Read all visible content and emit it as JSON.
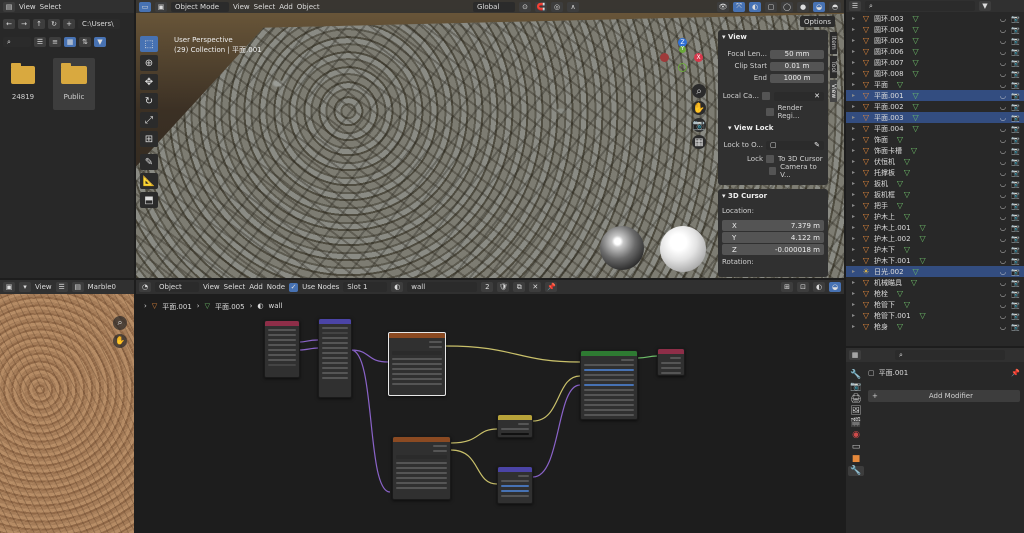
{
  "file_browser": {
    "view": "View",
    "select": "Select",
    "path": "C:\\Users\\",
    "items": [
      {
        "name": "24819"
      },
      {
        "name": "Public"
      }
    ]
  },
  "viewport": {
    "mode": "Object Mode",
    "view": "View",
    "select": "Select",
    "add": "Add",
    "object": "Object",
    "orientation": "Global",
    "options": "Options",
    "info_line1": "User Perspective",
    "info_line2": "(29) Collection | 平面.001",
    "axes": {
      "z": "Z",
      "y": "Y",
      "x": "X"
    }
  },
  "n_panel": {
    "tabs": [
      "Item",
      "Tool",
      "View"
    ],
    "view_section": "View",
    "focal_label": "Focal Len...",
    "focal": "50 mm",
    "clip_start_label": "Clip Start",
    "clip_start": "0.01 m",
    "end_label": "End",
    "end": "1000 m",
    "local_camera": "Local Ca...",
    "render_region": "Render Regi...",
    "view_lock": "View Lock",
    "lock_to_obj": "Lock to O...",
    "lock": "Lock",
    "to_3d_cursor": "To 3D Cursor",
    "camera_to_view": "Camera to V...",
    "cursor_section": "3D Cursor",
    "location": "Location:",
    "x_label": "X",
    "x": "7.379 m",
    "y_label": "Y",
    "y": "4.122 m",
    "z_label": "Z",
    "z": "-0.000018 m",
    "rotation": "Rotation:"
  },
  "image_editor": {
    "view": "View",
    "image_name": "Marble0"
  },
  "node_editor": {
    "object": "Object",
    "view": "View",
    "select": "Select",
    "add": "Add",
    "node": "Node",
    "use_nodes": "Use Nodes",
    "slot": "Slot 1",
    "material": "wall",
    "users": "2",
    "breadcrumb": [
      "平面.001",
      "平面.005",
      "wall"
    ]
  },
  "outliner": {
    "items": [
      {
        "name": "圆环.003",
        "icon": "▽",
        "color": "#e5893b",
        "sel": false
      },
      {
        "name": "圆环.004",
        "icon": "▽",
        "color": "#e5893b",
        "sel": false
      },
      {
        "name": "圆环.005",
        "icon": "▽",
        "color": "#e5893b",
        "sel": false
      },
      {
        "name": "圆环.006",
        "icon": "▽",
        "color": "#e5893b",
        "sel": false
      },
      {
        "name": "圆环.007",
        "icon": "▽",
        "color": "#e5893b",
        "sel": false
      },
      {
        "name": "圆环.008",
        "icon": "▽",
        "color": "#e5893b",
        "sel": false
      },
      {
        "name": "平面",
        "icon": "▽",
        "color": "#e5893b",
        "sel": false
      },
      {
        "name": "平面.001",
        "icon": "▽",
        "color": "#e5893b",
        "sel": true
      },
      {
        "name": "平面.002",
        "icon": "▽",
        "color": "#e5893b",
        "sel": false
      },
      {
        "name": "平面.003",
        "icon": "▽",
        "color": "#e5893b",
        "sel": true
      },
      {
        "name": "平面.004",
        "icon": "▽",
        "color": "#e5893b",
        "sel": false
      },
      {
        "name": "饰面",
        "icon": "▽",
        "color": "#e5893b",
        "sel": false
      },
      {
        "name": "饰面卡槽",
        "icon": "▽",
        "color": "#e5893b",
        "sel": false
      },
      {
        "name": "伏恒机",
        "icon": "▽",
        "color": "#e5893b",
        "sel": false
      },
      {
        "name": "托撑板",
        "icon": "▽",
        "color": "#e5893b",
        "sel": false
      },
      {
        "name": "扳机",
        "icon": "▽",
        "color": "#e5893b",
        "sel": false
      },
      {
        "name": "扳机框",
        "icon": "▽",
        "color": "#e5893b",
        "sel": false
      },
      {
        "name": "把手",
        "icon": "▽",
        "color": "#e5893b",
        "sel": false
      },
      {
        "name": "护木上",
        "icon": "▽",
        "color": "#e5893b",
        "sel": false
      },
      {
        "name": "护木上.001",
        "icon": "▽",
        "color": "#e5893b",
        "sel": false
      },
      {
        "name": "护木上.002",
        "icon": "▽",
        "color": "#e5893b",
        "sel": false
      },
      {
        "name": "护木下",
        "icon": "▽",
        "color": "#e5893b",
        "sel": false
      },
      {
        "name": "护木下.001",
        "icon": "▽",
        "color": "#e5893b",
        "sel": false
      },
      {
        "name": "日光.002",
        "icon": "☀",
        "color": "#d9b34a",
        "sel": true
      },
      {
        "name": "机械瞄具",
        "icon": "▽",
        "color": "#e5893b",
        "sel": false
      },
      {
        "name": "枪栓",
        "icon": "▽",
        "color": "#e5893b",
        "sel": false
      },
      {
        "name": "枪管下",
        "icon": "▽",
        "color": "#e5893b",
        "sel": false
      },
      {
        "name": "枪管下.001",
        "icon": "▽",
        "color": "#e5893b",
        "sel": false
      },
      {
        "name": "枪身",
        "icon": "▽",
        "color": "#e5893b",
        "sel": false
      }
    ]
  },
  "properties": {
    "object_name": "平面.001",
    "add_modifier": "Add Modifier"
  }
}
